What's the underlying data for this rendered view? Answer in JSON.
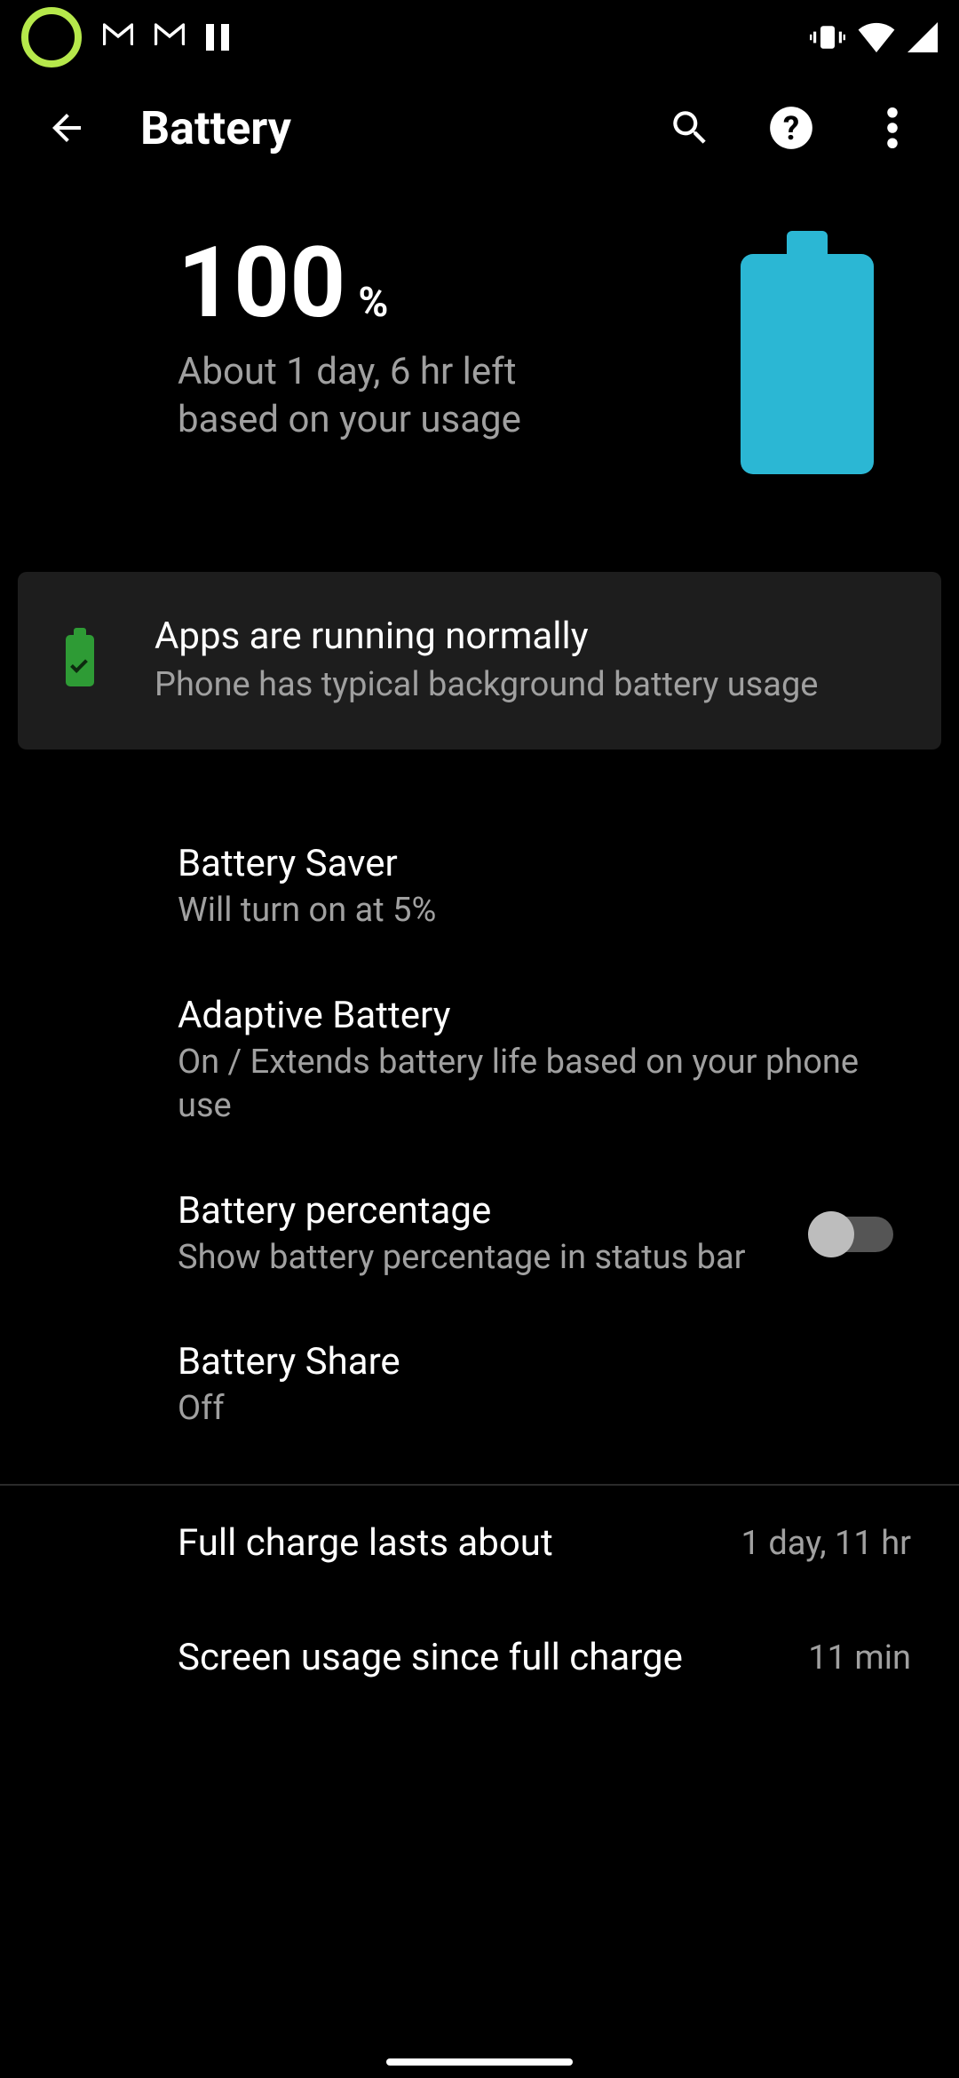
{
  "statusbar": {
    "left_icons": [
      "ring",
      "gmail",
      "gmail",
      "pause"
    ],
    "right_icons": [
      "vibrate",
      "wifi",
      "cell"
    ]
  },
  "appbar": {
    "title": "Battery"
  },
  "hero": {
    "percent": "100",
    "percent_symbol": "%",
    "estimate": "About 1 day, 6 hr left based on your usage",
    "battery_fill_color": "#2bb7d4"
  },
  "card": {
    "title": "Apps are running normally",
    "subtitle": "Phone has typical background battery usage"
  },
  "settings": [
    {
      "title": "Battery Saver",
      "subtitle": "Will turn on at 5%",
      "has_toggle": false
    },
    {
      "title": "Adaptive Battery",
      "subtitle": "On / Extends battery life based on your phone use",
      "has_toggle": false
    },
    {
      "title": "Battery percentage",
      "subtitle": "Show battery percentage in status bar",
      "has_toggle": true,
      "toggle_on": false
    },
    {
      "title": "Battery Share",
      "subtitle": "Off",
      "has_toggle": false
    }
  ],
  "stats": [
    {
      "label": "Full charge lasts about",
      "value": "1 day, 11 hr"
    },
    {
      "label": "Screen usage since full charge",
      "value": "11 min"
    }
  ]
}
